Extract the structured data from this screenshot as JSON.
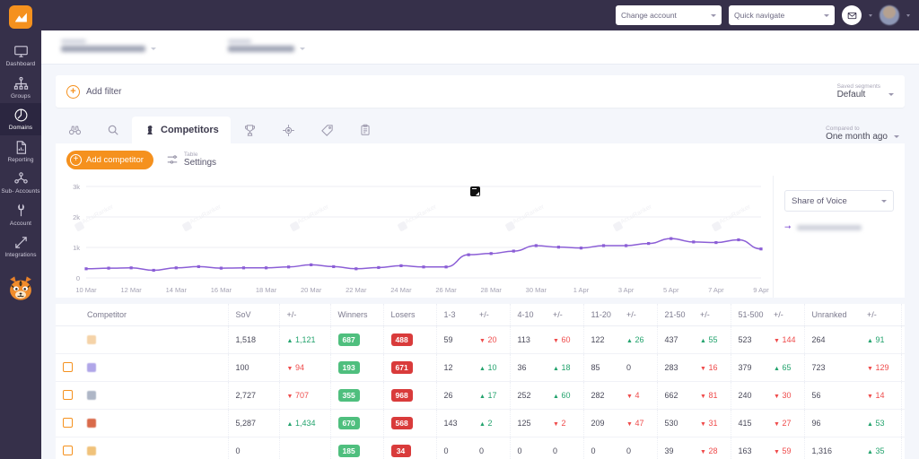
{
  "brand": {
    "accent": "#f5911e",
    "sidebar_bg": "#36304a",
    "line_color": "#8b5ed6",
    "up_color": "#23a36d",
    "down_color": "#ef4b4b"
  },
  "sidebar": {
    "logo_icon": "accuranker-logo-icon",
    "mascot_icon": "tiger-mascot-icon",
    "items": [
      {
        "label": "Dashboard",
        "icon": "monitor-icon",
        "active": false
      },
      {
        "label": "Groups",
        "icon": "sitemap-icon",
        "active": false
      },
      {
        "label": "Domains",
        "icon": "globe-icon",
        "active": true
      },
      {
        "label": "Reporting",
        "icon": "document-chart-icon",
        "active": false
      },
      {
        "label": "Sub-\nAccounts",
        "icon": "users-icon",
        "active": false
      },
      {
        "label": "Account",
        "icon": "wrench-icon",
        "active": false
      },
      {
        "label": "Integrations",
        "icon": "arrows-expand-icon",
        "active": false
      }
    ]
  },
  "topbar": {
    "change_account": "Change account",
    "quick_navigate": "Quick navigate",
    "mail_icon": "envelope-icon",
    "avatar_icon": "user-avatar",
    "chevron_icon": "chevron-down-icon"
  },
  "filterbar": {
    "add_filter_label": "Add filter",
    "plus_icon": "plus-circle-icon",
    "saved_segments_caption": "Saved segments",
    "saved_segments_value": "Default"
  },
  "tabs": {
    "items": [
      {
        "label": "",
        "icon": "binoculars-icon",
        "active": false
      },
      {
        "label": "",
        "icon": "search-icon",
        "active": false
      },
      {
        "label": "Competitors",
        "icon": "chess-pawn-icon",
        "active": true
      },
      {
        "label": "",
        "icon": "trophy-icon",
        "active": false
      },
      {
        "label": "",
        "icon": "target-icon",
        "active": false
      },
      {
        "label": "",
        "icon": "tag-icon",
        "active": false
      },
      {
        "label": "",
        "icon": "clipboard-icon",
        "active": false
      }
    ],
    "compared_caption": "Compared to",
    "compared_value": "One month ago"
  },
  "toolbar": {
    "add_competitor_label": "Add competitor",
    "add_icon": "plus-circle-icon",
    "table_settings_caption": "Table",
    "table_settings_value": "Settings",
    "settings_icon": "sliders-icon"
  },
  "chart_panel": {
    "metric_select_value": "Share of Voice",
    "metric_chevron_icon": "chevron-down-icon",
    "legend_arrow_icon": "arrow-right-icon",
    "legend_label": "",
    "note_marker_icon": "note-icon",
    "watermark": "AccuRanker"
  },
  "chart_data": {
    "type": "line",
    "title": "",
    "xlabel": "",
    "ylabel": "",
    "ylim": [
      0,
      3000
    ],
    "yticks": [
      0,
      1000,
      2000,
      3000
    ],
    "ytick_labels": [
      "0",
      "1k",
      "2k",
      "3k"
    ],
    "grid": true,
    "legend_position": "right",
    "x": [
      "10 Mar",
      "11 Mar",
      "12 Mar",
      "13 Mar",
      "14 Mar",
      "15 Mar",
      "16 Mar",
      "17 Mar",
      "18 Mar",
      "19 Mar",
      "20 Mar",
      "21 Mar",
      "22 Mar",
      "23 Mar",
      "24 Mar",
      "25 Mar",
      "26 Mar",
      "27 Mar",
      "28 Mar",
      "29 Mar",
      "30 Mar",
      "31 Mar",
      "1 Apr",
      "2 Apr",
      "3 Apr",
      "4 Apr",
      "5 Apr",
      "6 Apr",
      "7 Apr",
      "8 Apr",
      "9 Apr"
    ],
    "xtick_labels": [
      "10 Mar",
      "12 Mar",
      "14 Mar",
      "16 Mar",
      "18 Mar",
      "20 Mar",
      "22 Mar",
      "24 Mar",
      "26 Mar",
      "28 Mar",
      "30 Mar",
      "1 Apr",
      "3 Apr",
      "5 Apr",
      "7 Apr",
      "9 Apr"
    ],
    "series": [
      {
        "name": "Share of Voice",
        "color": "#8b5ed6",
        "values": [
          300,
          320,
          330,
          250,
          330,
          370,
          320,
          330,
          330,
          360,
          430,
          370,
          300,
          340,
          400,
          360,
          360,
          760,
          800,
          880,
          1060,
          1010,
          980,
          1060,
          1060,
          1130,
          1290,
          1180,
          1160,
          1250,
          950
        ]
      }
    ],
    "annotations": [
      {
        "x": "27 Mar",
        "type": "note",
        "label": ""
      }
    ]
  },
  "table": {
    "columns": [
      "",
      "Competitor",
      "SoV",
      "+/-",
      "Winners",
      "Losers",
      "1-3",
      "+/-",
      "4-10",
      "+/-",
      "11-20",
      "+/-",
      "21-50",
      "+/-",
      "51-500",
      "+/-",
      "Unranked",
      "+/-",
      ""
    ],
    "delete_icon": "trash-icon",
    "rows": [
      {
        "selected": false,
        "checkbox": false,
        "favicon_color": "#f5d3a8",
        "sov": "1,518",
        "sov_delta": "1,121",
        "sov_dir": "up",
        "winners": "687",
        "losers": "488",
        "r1_3": "59",
        "r1_3_delta": "20",
        "r1_3_dir": "down",
        "r4_10": "113",
        "r4_10_delta": "60",
        "r4_10_dir": "down",
        "r11_20": "122",
        "r11_20_delta": "26",
        "r11_20_dir": "up",
        "r21_50": "437",
        "r21_50_delta": "55",
        "r21_50_dir": "up",
        "r51_500": "523",
        "r51_500_delta": "144",
        "r51_500_dir": "down",
        "unranked": "264",
        "unranked_delta": "91",
        "unranked_dir": "up",
        "deletable": false
      },
      {
        "selected": false,
        "checkbox": true,
        "favicon_color": "#b0a6e8",
        "sov": "100",
        "sov_delta": "94",
        "sov_dir": "down",
        "winners": "193",
        "losers": "671",
        "r1_3": "12",
        "r1_3_delta": "10",
        "r1_3_dir": "up",
        "r4_10": "36",
        "r4_10_delta": "18",
        "r4_10_dir": "up",
        "r11_20": "85",
        "r11_20_delta": "0",
        "r11_20_dir": "none",
        "r21_50": "283",
        "r21_50_delta": "16",
        "r21_50_dir": "down",
        "r51_500": "379",
        "r51_500_delta": "65",
        "r51_500_dir": "up",
        "unranked": "723",
        "unranked_delta": "129",
        "unranked_dir": "down",
        "deletable": true
      },
      {
        "selected": false,
        "checkbox": true,
        "favicon_color": "#aeb6c6",
        "sov": "2,727",
        "sov_delta": "707",
        "sov_dir": "down",
        "winners": "355",
        "losers": "968",
        "r1_3": "26",
        "r1_3_delta": "17",
        "r1_3_dir": "up",
        "r4_10": "252",
        "r4_10_delta": "60",
        "r4_10_dir": "up",
        "r11_20": "282",
        "r11_20_delta": "4",
        "r11_20_dir": "down",
        "r21_50": "662",
        "r21_50_delta": "81",
        "r21_50_dir": "down",
        "r51_500": "240",
        "r51_500_delta": "30",
        "r51_500_dir": "down",
        "unranked": "56",
        "unranked_delta": "14",
        "unranked_dir": "down",
        "deletable": true
      },
      {
        "selected": false,
        "checkbox": true,
        "favicon_color": "#d96a4a",
        "sov": "5,287",
        "sov_delta": "1,434",
        "sov_dir": "up",
        "winners": "670",
        "losers": "568",
        "r1_3": "143",
        "r1_3_delta": "2",
        "r1_3_dir": "up",
        "r4_10": "125",
        "r4_10_delta": "2",
        "r4_10_dir": "down",
        "r11_20": "209",
        "r11_20_delta": "47",
        "r11_20_dir": "down",
        "r21_50": "530",
        "r21_50_delta": "31",
        "r21_50_dir": "down",
        "r51_500": "415",
        "r51_500_delta": "27",
        "r51_500_dir": "down",
        "unranked": "96",
        "unranked_delta": "53",
        "unranked_dir": "up",
        "deletable": true
      },
      {
        "selected": false,
        "checkbox": true,
        "favicon_color": "#f0c27a",
        "sov": "0",
        "sov_delta": "",
        "sov_dir": "none",
        "winners": "185",
        "losers": "34",
        "r1_3": "0",
        "r1_3_delta": "0",
        "r1_3_dir": "none",
        "r4_10": "0",
        "r4_10_delta": "0",
        "r4_10_dir": "none",
        "r11_20": "0",
        "r11_20_delta": "0",
        "r11_20_dir": "none",
        "r21_50": "39",
        "r21_50_delta": "28",
        "r21_50_dir": "down",
        "r51_500": "163",
        "r51_500_delta": "59",
        "r51_500_dir": "down",
        "unranked": "1,316",
        "unranked_delta": "35",
        "unranked_dir": "up",
        "deletable": true
      }
    ]
  }
}
